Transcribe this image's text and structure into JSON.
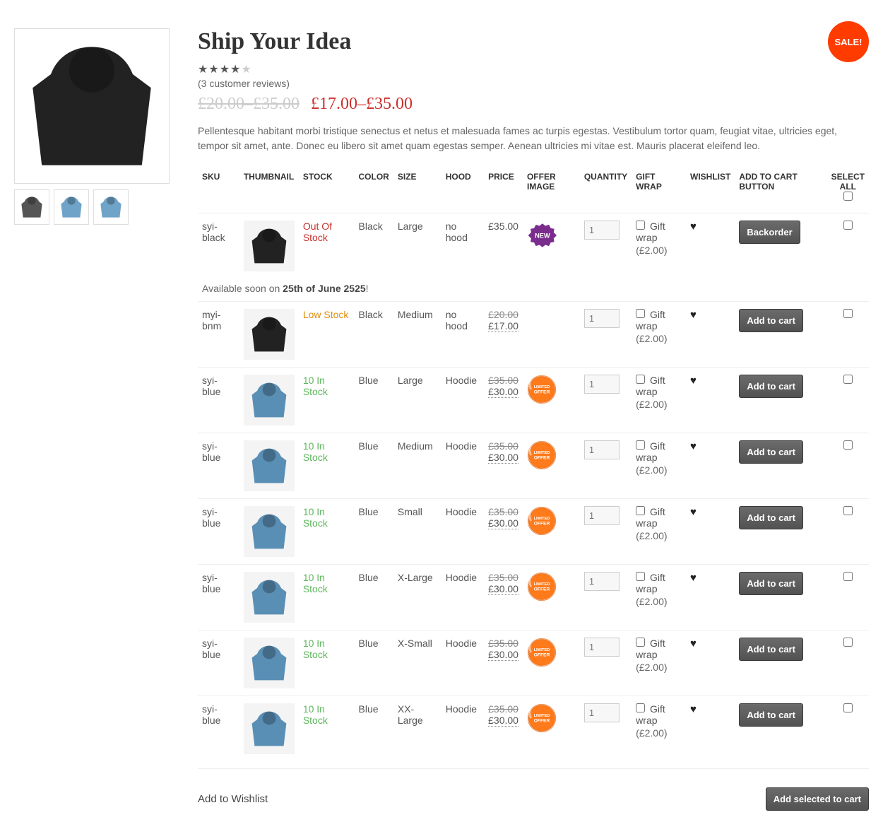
{
  "product": {
    "title": "Ship Your Idea",
    "sale_label": "SALE!",
    "reviews_text": "(3 customer reviews)",
    "old_price_range": "£20.00–£35.00",
    "new_price_range": "£17.00–£35.00",
    "description": "Pellentesque habitant morbi tristique senectus et netus et malesuada fames ac turpis egestas. Vestibulum tortor quam, feugiat vitae, ultricies eget, tempor sit amet, ante. Donec eu libero sit amet quam egestas semper. Aenean ultricies mi vitae est. Mauris placerat eleifend leo."
  },
  "columns": {
    "sku": "SKU",
    "thumbnail": "THUMBNAIL",
    "stock": "STOCK",
    "color": "COLOR",
    "size": "SIZE",
    "hood": "HOOD",
    "price": "PRICE",
    "offer_image": "OFFER IMAGE",
    "quantity": "QUANTITY",
    "gift_wrap": "GIFT WRAP",
    "wishlist": "WISHLIST",
    "add_to_cart": "ADD TO CART BUTTON",
    "select_all": "SELECT ALL"
  },
  "gift_wrap": {
    "label": "Gift wrap",
    "price_text": "(£2.00)"
  },
  "buttons": {
    "backorder": "Backorder",
    "add_to_cart": "Add to cart",
    "add_selected": "Add selected to cart"
  },
  "wishlist_link": "Add to Wishlist",
  "availability": {
    "prefix": "Available soon on ",
    "date": "25th of June 2525",
    "suffix": "!"
  },
  "rows": {
    "r0": {
      "sku": "syi-black",
      "stock": "Out Of Stock",
      "stock_cls": "stk-out",
      "color": "Black",
      "size": "Large",
      "hood": "no hood",
      "price": "£35.00",
      "offer": "new",
      "qty": "1",
      "btn": "Backorder",
      "thumb": "black"
    },
    "r1": {
      "sku": "myi-bnm",
      "stock": "Low Stock",
      "stock_cls": "stk-low",
      "color": "Black",
      "size": "Medium",
      "hood": "no hood",
      "old_price": "£20.00",
      "new_price": "£17.00",
      "offer": "",
      "qty": "1",
      "btn": "Add to cart",
      "thumb": "black"
    },
    "r2": {
      "sku": "syi-blue",
      "stock": "10 In Stock",
      "stock_cls": "stk-in",
      "color": "Blue",
      "size": "Large",
      "hood": "Hoodie",
      "old_price": "£35.00",
      "new_price": "£30.00",
      "offer": "limited",
      "qty": "1",
      "btn": "Add to cart",
      "thumb": "blue"
    },
    "r3": {
      "sku": "syi-blue",
      "stock": "10 In Stock",
      "stock_cls": "stk-in",
      "color": "Blue",
      "size": "Medium",
      "hood": "Hoodie",
      "old_price": "£35.00",
      "new_price": "£30.00",
      "offer": "limited",
      "qty": "1",
      "btn": "Add to cart",
      "thumb": "blue"
    },
    "r4": {
      "sku": "syi-blue",
      "stock": "10 In Stock",
      "stock_cls": "stk-in",
      "color": "Blue",
      "size": "Small",
      "hood": "Hoodie",
      "old_price": "£35.00",
      "new_price": "£30.00",
      "offer": "limited",
      "qty": "1",
      "btn": "Add to cart",
      "thumb": "blue"
    },
    "r5": {
      "sku": "syi-blue",
      "stock": "10 In Stock",
      "stock_cls": "stk-in",
      "color": "Blue",
      "size": "X-Large",
      "hood": "Hoodie",
      "old_price": "£35.00",
      "new_price": "£30.00",
      "offer": "limited",
      "qty": "1",
      "btn": "Add to cart",
      "thumb": "blue"
    },
    "r6": {
      "sku": "syi-blue",
      "stock": "10 In Stock",
      "stock_cls": "stk-in",
      "color": "Blue",
      "size": "X-Small",
      "hood": "Hoodie",
      "old_price": "£35.00",
      "new_price": "£30.00",
      "offer": "limited",
      "qty": "1",
      "btn": "Add to cart",
      "thumb": "blue"
    },
    "r7": {
      "sku": "syi-blue",
      "stock": "10 In Stock",
      "stock_cls": "stk-in",
      "color": "Blue",
      "size": "XX-Large",
      "hood": "Hoodie",
      "old_price": "£35.00",
      "new_price": "£30.00",
      "offer": "limited",
      "qty": "1",
      "btn": "Add to cart",
      "thumb": "blue"
    }
  }
}
